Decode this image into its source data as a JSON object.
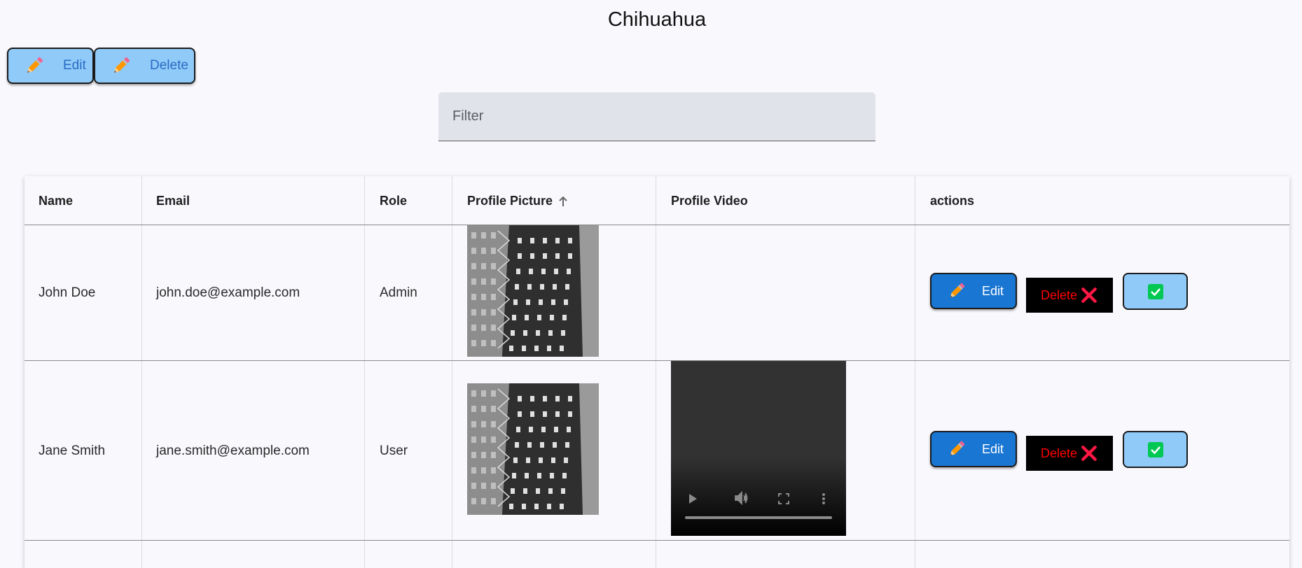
{
  "page": {
    "title": "Chihuahua"
  },
  "toolbar": {
    "edit_label": "Edit",
    "delete_label": "Delete"
  },
  "filter": {
    "placeholder": "Filter",
    "value": ""
  },
  "table": {
    "columns": [
      "Name",
      "Email",
      "Role",
      "Profile Picture",
      "Profile Video",
      "actions"
    ],
    "sorted_column": "Profile Picture",
    "sort_direction": "ascending",
    "rows": [
      {
        "name": "John Doe",
        "email": "john.doe@example.com",
        "role": "Admin",
        "has_picture": true,
        "has_video": false
      },
      {
        "name": "Jane Smith",
        "email": "jane.smith@example.com",
        "role": "User",
        "has_picture": true,
        "has_video": true
      }
    ],
    "row_actions": {
      "edit_label": "Edit",
      "delete_label": "Delete"
    }
  },
  "colors": {
    "background": "#f9f8fd",
    "light_button": "#90caf9",
    "primary_button": "#1976d2",
    "delete_text": "#ff0000",
    "check_icon": "#00c853"
  },
  "icons": [
    "pencil-icon",
    "sort-arrow-up-icon",
    "close-icon",
    "check-icon",
    "play-icon",
    "volume-icon",
    "fullscreen-icon",
    "more-vert-icon"
  ]
}
